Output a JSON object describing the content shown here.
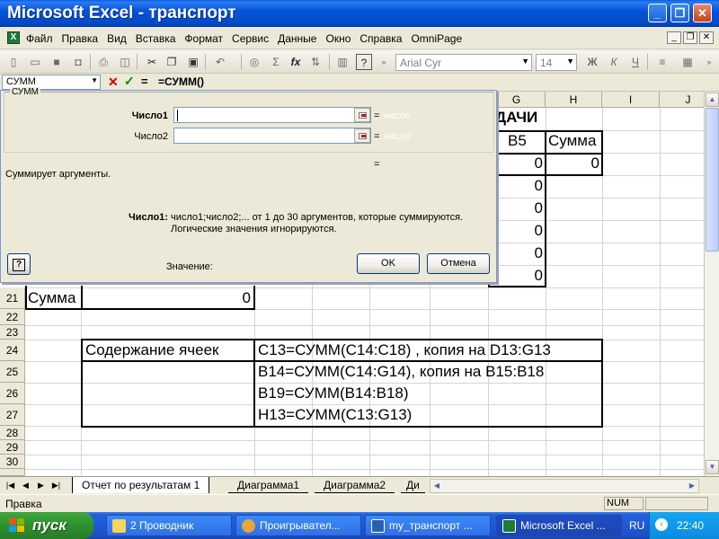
{
  "window": {
    "title": "Microsoft Excel - транспорт",
    "minimize": "_",
    "restore": "❐",
    "close": "✕"
  },
  "menu": {
    "items": [
      "Файл",
      "Правка",
      "Вид",
      "Вставка",
      "Формат",
      "Сервис",
      "Данные",
      "Окно",
      "Справка",
      "OmniPage"
    ]
  },
  "toolbar": {
    "font_name": "Arial Cyr",
    "font_size": "14",
    "bold": "Ж",
    "italic": "К",
    "underline": "Ч"
  },
  "formula_bar": {
    "name_box": "СУММ",
    "cancel": "✕",
    "enter": "✓",
    "equals": "=",
    "formula": "=СУММ()"
  },
  "grid": {
    "columns": [
      "G",
      "H",
      "I",
      "J"
    ],
    "rows": [
      "21",
      "22",
      "23",
      "24",
      "25",
      "26",
      "27",
      "28",
      "29",
      "30"
    ],
    "header_partial": "ДАЧИ",
    "col_g_header": "В5",
    "col_h_header": "Сумма",
    "h13_value": "0",
    "g_values": [
      "0",
      "0",
      "0",
      "0",
      "0",
      "0"
    ],
    "row21_label": "Сумма",
    "row21_value": "0",
    "contents_label": "Содержание ячеек",
    "contents": [
      "C13=СУММ(C14:C18) , копия на D13:G13",
      "B14=СУММ(C14:G14), копия на B15:B18",
      "B19=СУММ(B14:B18)",
      "H13=СУММ(C13:G13)"
    ]
  },
  "dialog": {
    "group_label": "СУММ",
    "arg1_label": "Число1",
    "arg2_label": "Число2",
    "arg_type": "число",
    "eq": "=",
    "result_eq": "=",
    "description": "Суммирует аргументы.",
    "arg_help_label": "Число1:",
    "arg_help_line1": "число1;число2;... от 1 до 30 аргументов, которые суммируются.",
    "arg_help_line2": "Логические значения игнорируются.",
    "value_label": "Значение:",
    "help_glyph": "?",
    "ok": "OK",
    "cancel": "Отмена"
  },
  "sheets": {
    "tabs": [
      "Отчет по результатам 1",
      "Диаграмма1",
      "Диаграмма2",
      "Ди"
    ]
  },
  "status": {
    "text": "Правка",
    "num": "NUM"
  },
  "taskbar": {
    "start": "пуск",
    "items": [
      "2 Проводник",
      "Проигрывател...",
      "my_транспорт ...",
      "Microsoft Excel ..."
    ],
    "lang": "RU",
    "clock": "22:40"
  }
}
